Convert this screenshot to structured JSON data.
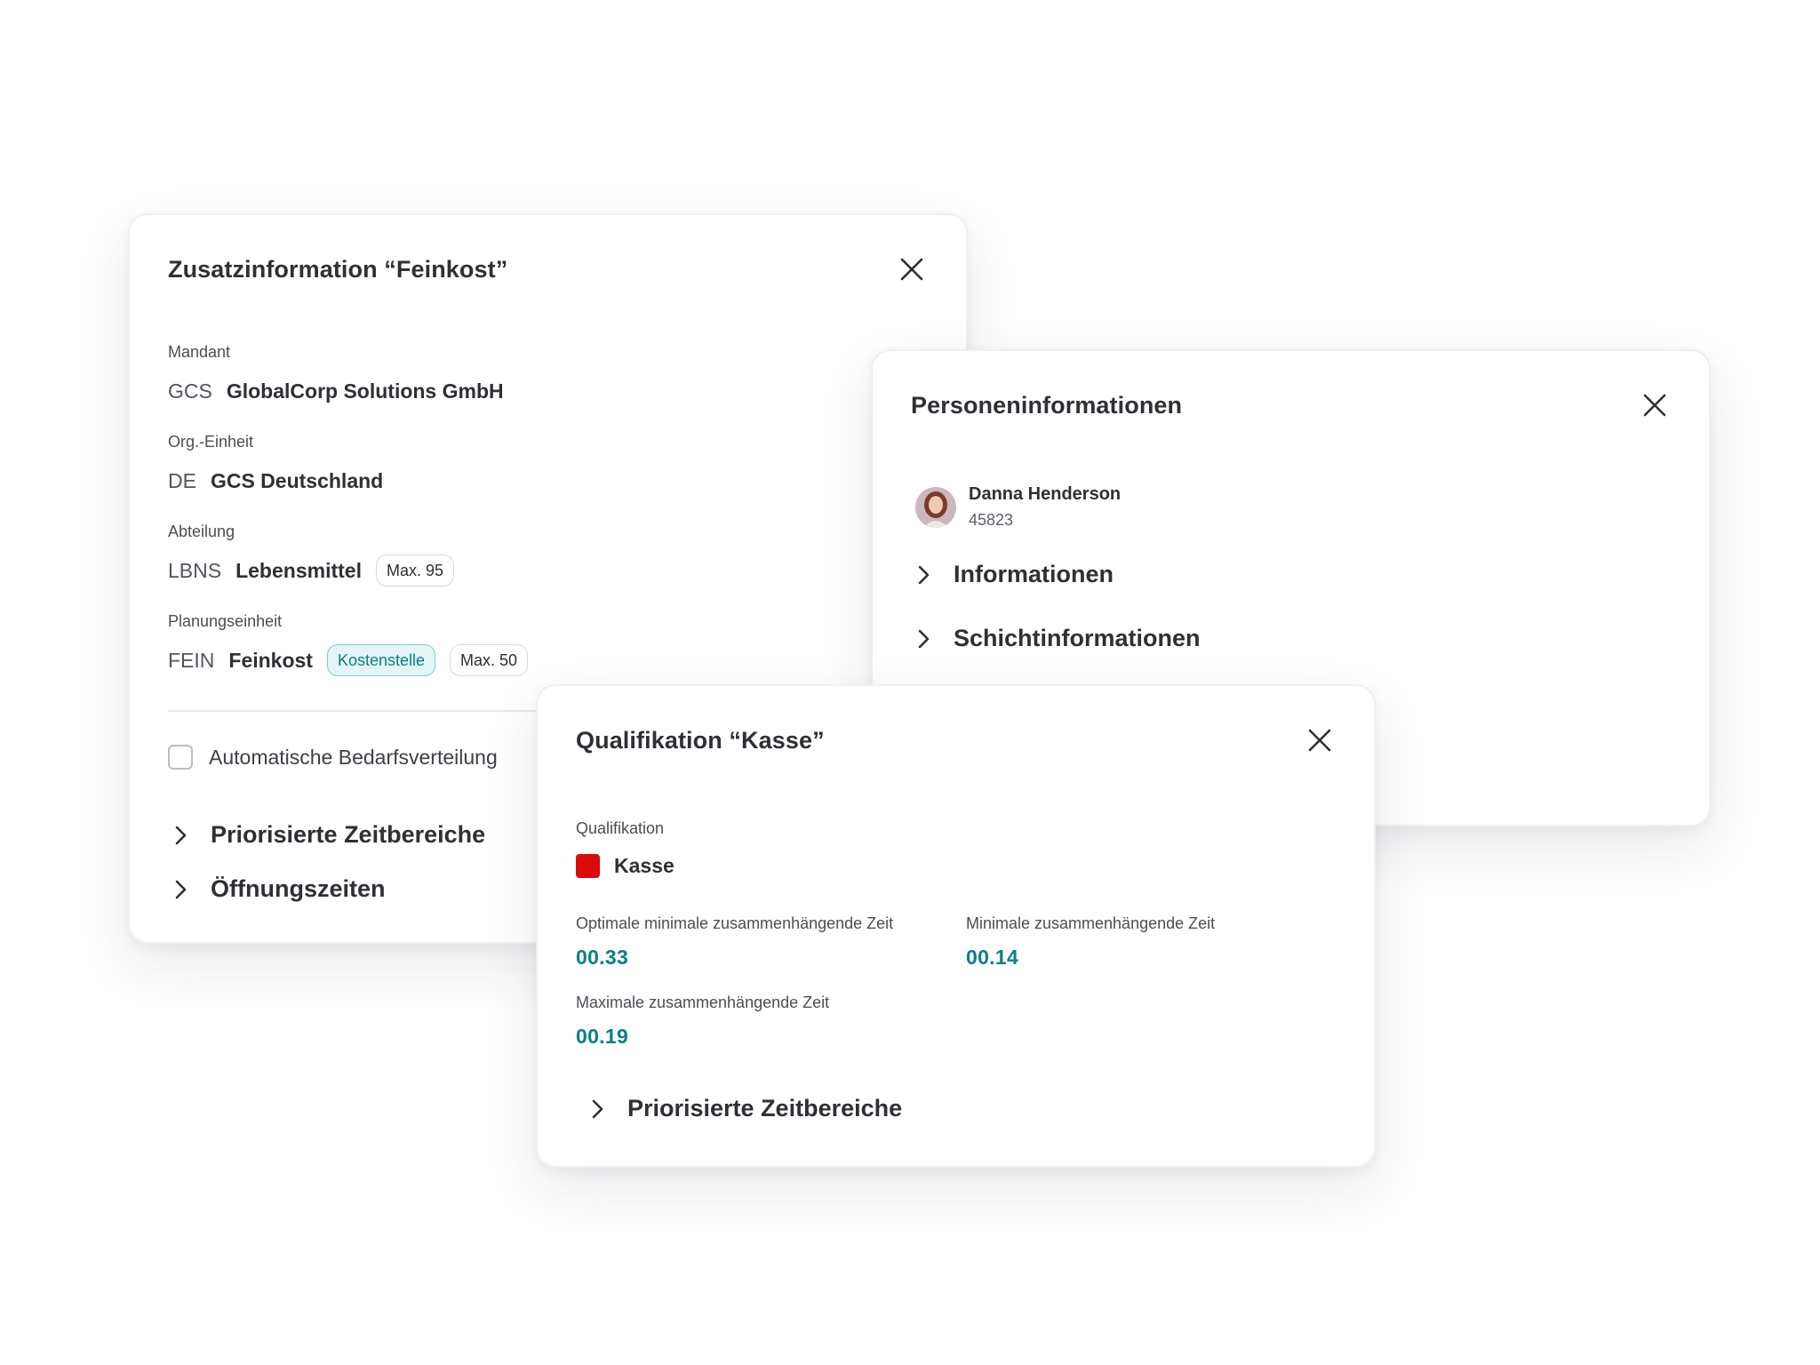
{
  "feinkost": {
    "title": "Zusatzinformation “Feinkost”",
    "mandant": {
      "label": "Mandant",
      "code": "GCS",
      "name": "GlobalCorp Solutions GmbH"
    },
    "org": {
      "label": "Org.-Einheit",
      "code": "DE",
      "name": "GCS Deutschland"
    },
    "abteilung": {
      "label": "Abteilung",
      "code": "LBNS",
      "name": "Lebensmittel",
      "max": "Max. 95"
    },
    "planung": {
      "label": "Planungseinheit",
      "code": "FEIN",
      "name": "Feinkost",
      "tag": "Kostenstelle",
      "max": "Max. 50"
    },
    "checkbox_label": "Automatische Bedarfsverteilung",
    "expanders": [
      "Priorisierte Zeitbereiche",
      "Öffnungszeiten"
    ]
  },
  "person": {
    "title": "Personeninformationen",
    "name": "Danna Henderson",
    "id": "45823",
    "expanders": [
      "Informationen",
      "Schichtinformationen"
    ]
  },
  "kasse": {
    "title": "Qualifikation “Kasse”",
    "qual_label": "Qualifikation",
    "qual_name": "Kasse",
    "qual_color": "#d90a0a",
    "stats": [
      {
        "label": "Optimale minimale zusammenhängende Zeit",
        "value": "00.33"
      },
      {
        "label": "Minimale zusammenhängende Zeit",
        "value": "00.14"
      },
      {
        "label": "Maximale zusammenhängende Zeit",
        "value": "00.19"
      }
    ],
    "expander": "Priorisierte Zeitbereiche"
  },
  "colors": {
    "accent": "#0a7f8a",
    "text": "#2d3034",
    "swatch": "#d90a0a"
  }
}
